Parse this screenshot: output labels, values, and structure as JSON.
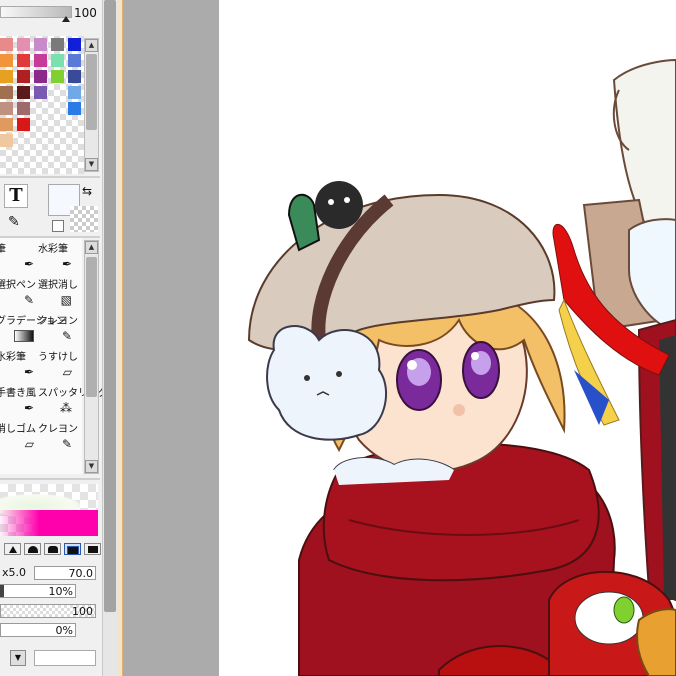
{
  "panel": {
    "opacity_value": "100",
    "tool_labels": [
      "筆",
      "水彩筆",
      "選択ペン",
      "選択消し",
      "グラデーション",
      "クレヨン",
      "水彩筆",
      "うすけし",
      "手書き風",
      "スパッタリング",
      "消しゴム",
      "クレヨン"
    ],
    "text_tool_glyph": "T",
    "brush_size_value": "70.0",
    "brush_size_prefix": "x5.0",
    "density_value": "10%",
    "blend_value": "100",
    "min_value": "0%"
  },
  "colors": {
    "accent_magenta": "#ff00ad",
    "panel_bg": "#f0f0f0",
    "canvas_bg": "#ffffff",
    "scarf_red": "#a0111f",
    "hat_beige": "#d9cbbd"
  },
  "icons": [
    "swap-arrows-icon",
    "eyedropper-icon",
    "text-tool-icon",
    "pen-icon",
    "eraser-icon",
    "dropdown-arrow-icon",
    "scroll-up-icon",
    "scroll-down-icon"
  ]
}
